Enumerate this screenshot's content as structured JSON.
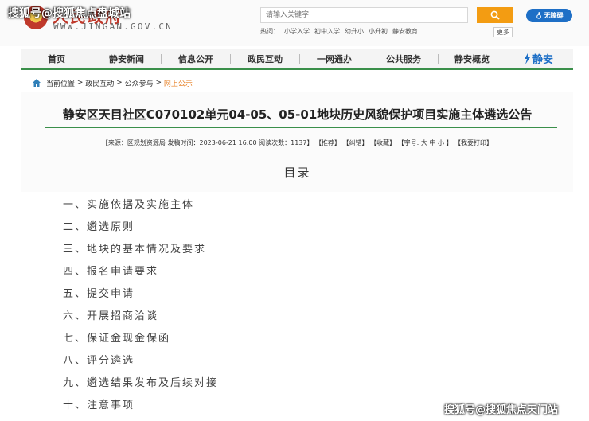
{
  "watermark_top": "搜狐号@搜狐焦点盘城站",
  "header": {
    "site_name": "人民政府",
    "site_url": "WWW.JINGAN.GOV.CN",
    "search_placeholder": "请输入关键字",
    "accessibility_label": "无障碍",
    "hot_label": "热词：",
    "hot_words": [
      "小学入学",
      "初中入学",
      "幼升小",
      "小升初",
      "静安教育"
    ],
    "more_label": "更多"
  },
  "nav": {
    "items": [
      "首页",
      "静安新闻",
      "信息公开",
      "政民互动",
      "一网通办",
      "公共服务",
      "静安概览"
    ],
    "logo_text": "静安"
  },
  "breadcrumb": {
    "prefix": "当前位置",
    "items": [
      "政民互动",
      "公众参与"
    ],
    "current": "网上公示"
  },
  "article": {
    "title": "静安区天目社区C070102单元04-05、05-01地块历史风貌保护项目实施主体遴选公告",
    "meta": "【来源：区规划资源局  发稿时间：2023-06-21 16:00  阅读次数：1137】  【推荐】  【纠错】  【收藏】  【字号: 大 中 小 】  【我要打印】",
    "toc_heading": "目录",
    "toc": [
      "一、实施依据及实施主体",
      "二、遴选原则",
      "三、地块的基本情况及要求",
      "四、报名申请要求",
      "五、提交申请",
      "六、开展招商洽谈",
      "七、保证金现金保函",
      "八、评分遴选",
      "九、遴选结果发布及后续对接",
      "十、注意事项"
    ]
  },
  "watermark_bottom": "搜狐号@搜狐焦点天门站",
  "colors": {
    "brand_red": "#c0392b",
    "accent_orange": "#f39c12",
    "nav_green": "#3a8f4a",
    "access_blue": "#1e6fc6"
  }
}
